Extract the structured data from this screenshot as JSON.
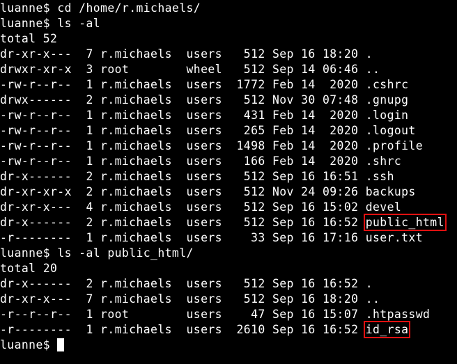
{
  "terminal": {
    "prompt": "luanne$ ",
    "commands": {
      "cd": "cd /home/r.michaels/",
      "ls1": "ls -al",
      "ls2": "ls -al public_html/"
    },
    "listing1": {
      "total": "total 52",
      "rows": [
        {
          "meta": "dr-xr-x---  7 r.michaels  users   512 Sep 16 18:20 ",
          "name": "."
        },
        {
          "meta": "drwxr-xr-x  3 root        wheel   512 Sep 14 06:46 ",
          "name": ".."
        },
        {
          "meta": "-rw-r--r--  1 r.michaels  users  1772 Feb 14  2020 ",
          "name": ".cshrc"
        },
        {
          "meta": "drwx------  2 r.michaels  users   512 Nov 30 07:48 ",
          "name": ".gnupg"
        },
        {
          "meta": "-rw-r--r--  1 r.michaels  users   431 Feb 14  2020 ",
          "name": ".login"
        },
        {
          "meta": "-rw-r--r--  1 r.michaels  users   265 Feb 14  2020 ",
          "name": ".logout"
        },
        {
          "meta": "-rw-r--r--  1 r.michaels  users  1498 Feb 14  2020 ",
          "name": ".profile"
        },
        {
          "meta": "-rw-r--r--  1 r.michaels  users   166 Feb 14  2020 ",
          "name": ".shrc"
        },
        {
          "meta": "dr-x------  2 r.michaels  users   512 Sep 16 16:51 ",
          "name": ".ssh"
        },
        {
          "meta": "dr-xr-xr-x  2 r.michaels  users   512 Nov 24 09:26 ",
          "name": "backups"
        },
        {
          "meta": "dr-xr-x---  4 r.michaels  users   512 Sep 16 15:02 ",
          "name": "devel"
        },
        {
          "meta": "dr-x------  2 r.michaels  users   512 Sep 16 16:52 ",
          "name": "public_html"
        },
        {
          "meta": "-r--------  1 r.michaels  users    33 Sep 16 17:16 ",
          "name": "user.txt"
        }
      ]
    },
    "listing2": {
      "total": "total 20",
      "rows": [
        {
          "meta": "dr-x------  2 r.michaels  users   512 Sep 16 16:52 ",
          "name": "."
        },
        {
          "meta": "dr-xr-x---  7 r.michaels  users   512 Sep 16 18:20 ",
          "name": ".."
        },
        {
          "meta": "-r--r--r--  1 root        users    47 Sep 16 15:07 ",
          "name": ".htpasswd"
        },
        {
          "meta": "-r--------  1 r.michaels  users  2610 Sep 16 16:52 ",
          "name": "id_rsa"
        }
      ]
    }
  },
  "colors": {
    "background": "#000000",
    "text": "#ffffff",
    "highlight": "#e01010"
  }
}
